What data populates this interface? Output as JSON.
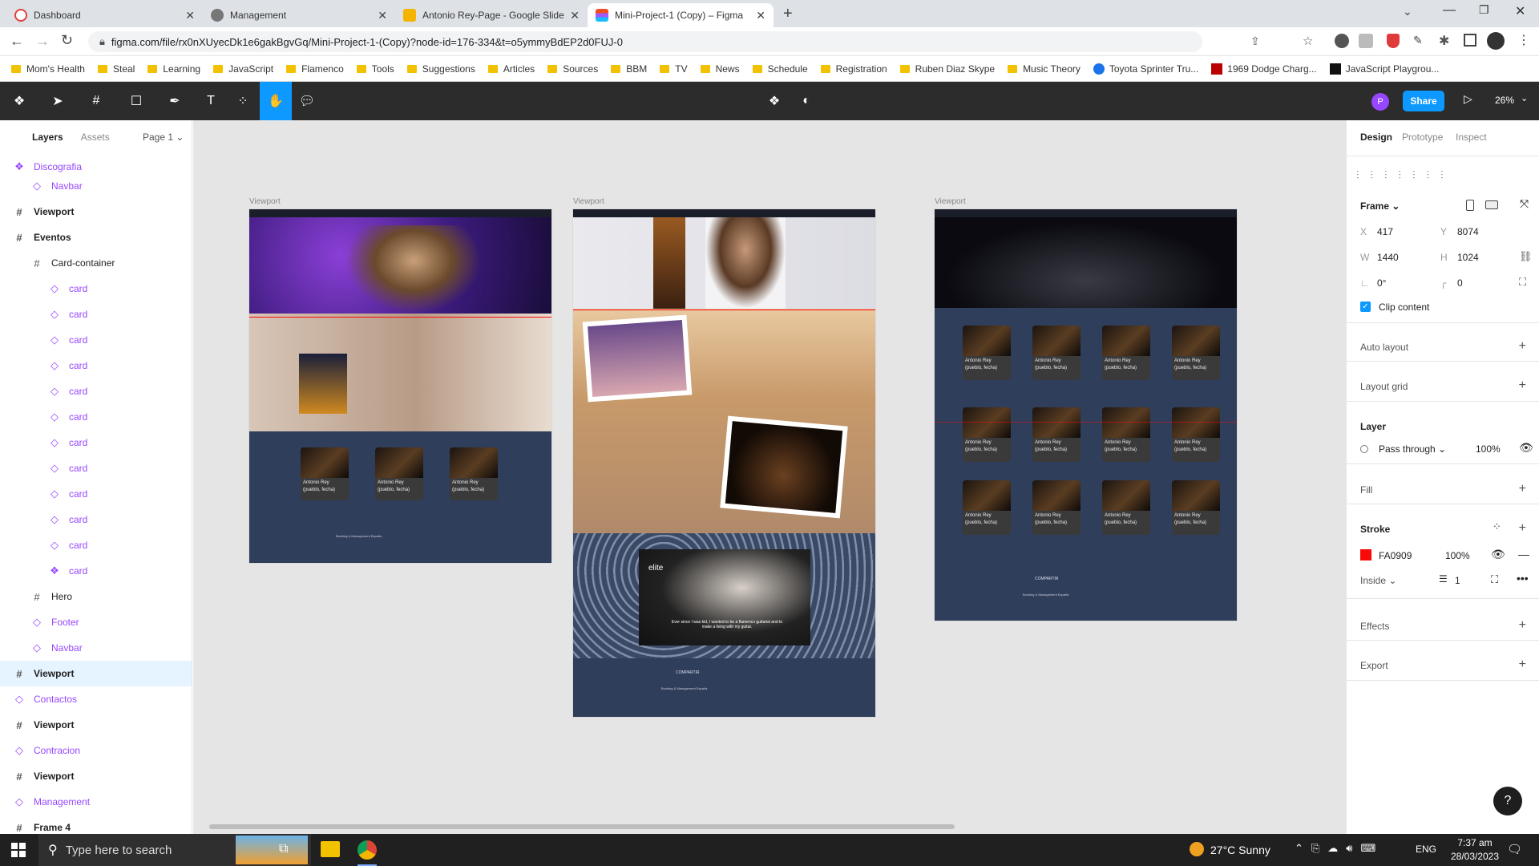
{
  "browser": {
    "tabs": [
      {
        "title": "Dashboard",
        "icon": "dashboard-favicon-icon"
      },
      {
        "title": "Management",
        "icon": "globe-favicon-icon"
      },
      {
        "title": "Antonio Rey-Page - Google Slide",
        "icon": "slides-favicon-icon"
      },
      {
        "title": "Mini-Project-1 (Copy) – Figma",
        "icon": "figma-favicon-icon"
      }
    ],
    "url": "figma.com/file/rx0nXUyecDk1e6gakBgvGq/Mini-Project-1-(Copy)?node-id=176-334&t=o5ymmyBdEP2d0FUJ-0",
    "bookmarks": [
      "Mom's Health",
      "Steal",
      "Learning",
      "JavaScript",
      "Flamenco",
      "Tools",
      "Suggestions",
      "Articles",
      "Sources",
      "BBM",
      "TV",
      "News",
      "Schedule",
      "Registration",
      "Ruben Diaz Skype",
      "Music Theory",
      "Toyota Sprinter Tru...",
      "1969 Dodge Charg...",
      "JavaScript Playgrou..."
    ]
  },
  "figma_toolbar": {
    "avatar_letter": "P",
    "share_label": "Share",
    "zoom": "26%"
  },
  "left_panel": {
    "tabs": {
      "layers": "Layers",
      "assets": "Assets"
    },
    "page": "Page 1",
    "layers": [
      {
        "name": "Discografia",
        "type": "component",
        "indent": 0
      },
      {
        "name": "Navbar",
        "type": "instance",
        "indent": 1
      },
      {
        "name": "Viewport",
        "type": "frame",
        "indent": 0
      },
      {
        "name": "Eventos",
        "type": "frame",
        "indent": 0
      },
      {
        "name": "Card-container",
        "type": "frame",
        "indent": 1
      },
      {
        "name": "card",
        "type": "instance",
        "indent": 2
      },
      {
        "name": "card",
        "type": "instance",
        "indent": 2
      },
      {
        "name": "card",
        "type": "instance",
        "indent": 2
      },
      {
        "name": "card",
        "type": "instance",
        "indent": 2
      },
      {
        "name": "card",
        "type": "instance",
        "indent": 2
      },
      {
        "name": "card",
        "type": "instance",
        "indent": 2
      },
      {
        "name": "card",
        "type": "instance",
        "indent": 2
      },
      {
        "name": "card",
        "type": "instance",
        "indent": 2
      },
      {
        "name": "card",
        "type": "instance",
        "indent": 2
      },
      {
        "name": "card",
        "type": "instance",
        "indent": 2
      },
      {
        "name": "card",
        "type": "instance",
        "indent": 2
      },
      {
        "name": "card",
        "type": "component",
        "indent": 2
      },
      {
        "name": "Hero",
        "type": "frame",
        "indent": 1
      },
      {
        "name": "Footer",
        "type": "instance",
        "indent": 1
      },
      {
        "name": "Navbar",
        "type": "instance",
        "indent": 1
      },
      {
        "name": "Viewport",
        "type": "frame",
        "indent": 0,
        "selected": true
      },
      {
        "name": "Contactos",
        "type": "instance",
        "indent": 0
      },
      {
        "name": "Viewport",
        "type": "frame",
        "indent": 0
      },
      {
        "name": "Contracion",
        "type": "instance",
        "indent": 0
      },
      {
        "name": "Viewport",
        "type": "frame",
        "indent": 0
      },
      {
        "name": "Management",
        "type": "instance",
        "indent": 0
      },
      {
        "name": "Frame 4",
        "type": "frame",
        "indent": 0
      }
    ]
  },
  "canvas": {
    "frame_labels": [
      "Viewport",
      "Viewport",
      "Viewport"
    ],
    "card_text": "Antonio Rey (pueblo, fecha)",
    "footer_share": "COMPARTIR",
    "footer_booking": "Booking & Management España",
    "video_caption": "Ever since I was kid, I wanted to be a flamenco guitarist and to make a living with my guitar.",
    "elite_logo": "elite"
  },
  "right_panel": {
    "tabs": {
      "design": "Design",
      "prototype": "Prototype",
      "inspect": "Inspect"
    },
    "frame_title": "Frame",
    "x_label": "X",
    "x": "417",
    "y_label": "Y",
    "y": "8074",
    "w_label": "W",
    "w": "1440",
    "h_label": "H",
    "h": "1024",
    "rotation": "0°",
    "radius": "0",
    "clip_content": "Clip content",
    "auto_layout": "Auto layout",
    "layout_grid": "Layout grid",
    "layer_title": "Layer",
    "blend": "Pass through",
    "opacity": "100%",
    "fill": "Fill",
    "stroke_title": "Stroke",
    "stroke_color": "FA0909",
    "stroke_hex": "#FA0909",
    "stroke_opacity": "100%",
    "stroke_position": "Inside",
    "stroke_weight": "1",
    "effects": "Effects",
    "export": "Export"
  },
  "taskbar": {
    "search_placeholder": "Type here to search",
    "weather": "27°C  Sunny",
    "lang": "ENG",
    "time": "7:37 am",
    "date": "28/03/2023"
  }
}
